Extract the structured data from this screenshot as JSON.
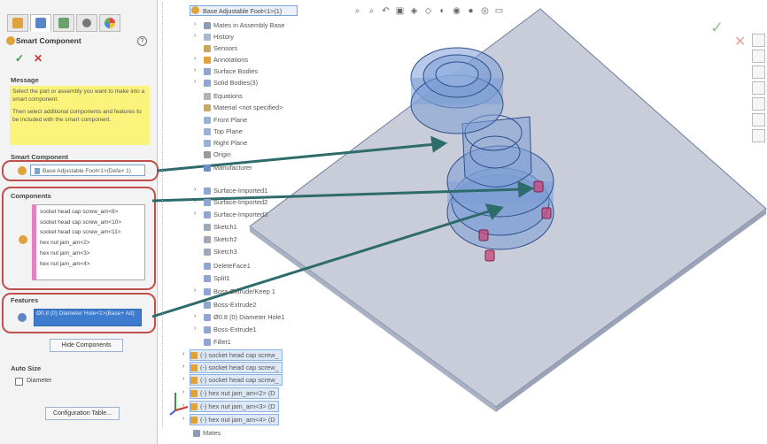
{
  "panel": {
    "title": "Smart Component",
    "help_icon": "?",
    "ok_icon": "checkmark-icon",
    "cancel_icon": "close-icon",
    "message_header": "Message",
    "message_line1": "Select the part or assembly you want to make into a smart component.",
    "message_line2": "Then select additional components and features to be included with the smart component.",
    "smart_component_header": "Smart Component",
    "smart_component_value": "Base Adjustable Foot<1>(Defa+ 1)",
    "components_header": "Components",
    "components": [
      "socket head cap screw_am<8>",
      "socket head cap screw_am<10>",
      "socket head cap screw_am<11>",
      "hex nut jam_am<2>",
      "hex nut jam_am<3>",
      "hex nut jam_am<4>"
    ],
    "features_header": "Features",
    "features_value": "Ø0.8 (0) Diameter Hole<1>(Base+ Ad)",
    "hide_components_label": "Hide Components",
    "auto_size_header": "Auto Size",
    "diameter_label": "Diameter",
    "configuration_table_label": "Configuration Table..."
  },
  "tree": {
    "root": "Base Adjustable Foot<1>(1)",
    "items": [
      "Mates in Assembly Base",
      "History",
      "Sensors",
      "Annotations",
      "Surface Bodies",
      "Solid Bodies(3)",
      "Equations",
      "Material <not specified>",
      "Front Plane",
      "Top Plane",
      "Right Plane",
      "Origin",
      "Manufacturer",
      "Surface-Imported1",
      "Surface-Imported2",
      "Surface-Imported3",
      "Sketch1",
      "Sketch2",
      "Sketch3",
      "DeleteFace1",
      "Split1",
      "Boss-Extrude/Keep 1",
      "Boss-Extrude2",
      "Ø0.8 (0) Diameter Hole1",
      "Boss-Extrude1",
      "Fillet1"
    ],
    "components": [
      "(-) socket head cap screw_",
      "(-) socket head cap screw_",
      "(-) socket head cap screw_",
      "(-) hex nut jam_am<2> (D",
      "(-) hex nut jam_am<3> (D",
      "(-) hex nut jam_am<4> (D"
    ],
    "mates": "Mates"
  },
  "colors": {
    "yellow": "#fbf37c",
    "highlight_circle": "#c0504d",
    "arrow": "#2e6b6b",
    "part": "#5f86c9",
    "plate": "#c8cdd9"
  }
}
